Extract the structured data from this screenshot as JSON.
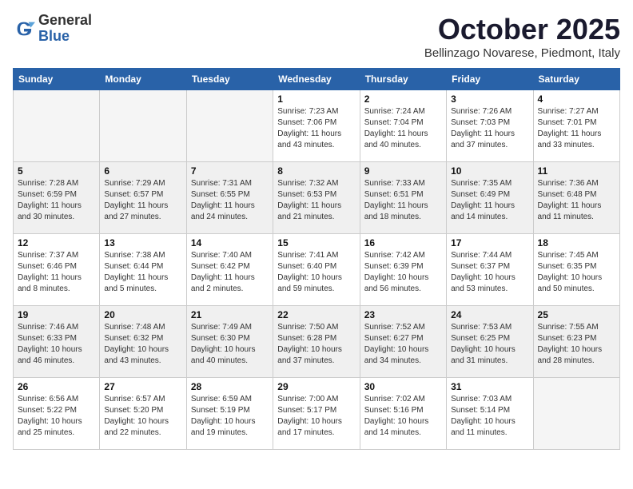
{
  "logo": {
    "general": "General",
    "blue": "Blue"
  },
  "title": "October 2025",
  "location": "Bellinzago Novarese, Piedmont, Italy",
  "weekdays": [
    "Sunday",
    "Monday",
    "Tuesday",
    "Wednesday",
    "Thursday",
    "Friday",
    "Saturday"
  ],
  "weeks": [
    [
      {
        "day": "",
        "info": ""
      },
      {
        "day": "",
        "info": ""
      },
      {
        "day": "",
        "info": ""
      },
      {
        "day": "1",
        "info": "Sunrise: 7:23 AM\nSunset: 7:06 PM\nDaylight: 11 hours\nand 43 minutes."
      },
      {
        "day": "2",
        "info": "Sunrise: 7:24 AM\nSunset: 7:04 PM\nDaylight: 11 hours\nand 40 minutes."
      },
      {
        "day": "3",
        "info": "Sunrise: 7:26 AM\nSunset: 7:03 PM\nDaylight: 11 hours\nand 37 minutes."
      },
      {
        "day": "4",
        "info": "Sunrise: 7:27 AM\nSunset: 7:01 PM\nDaylight: 11 hours\nand 33 minutes."
      }
    ],
    [
      {
        "day": "5",
        "info": "Sunrise: 7:28 AM\nSunset: 6:59 PM\nDaylight: 11 hours\nand 30 minutes."
      },
      {
        "day": "6",
        "info": "Sunrise: 7:29 AM\nSunset: 6:57 PM\nDaylight: 11 hours\nand 27 minutes."
      },
      {
        "day": "7",
        "info": "Sunrise: 7:31 AM\nSunset: 6:55 PM\nDaylight: 11 hours\nand 24 minutes."
      },
      {
        "day": "8",
        "info": "Sunrise: 7:32 AM\nSunset: 6:53 PM\nDaylight: 11 hours\nand 21 minutes."
      },
      {
        "day": "9",
        "info": "Sunrise: 7:33 AM\nSunset: 6:51 PM\nDaylight: 11 hours\nand 18 minutes."
      },
      {
        "day": "10",
        "info": "Sunrise: 7:35 AM\nSunset: 6:49 PM\nDaylight: 11 hours\nand 14 minutes."
      },
      {
        "day": "11",
        "info": "Sunrise: 7:36 AM\nSunset: 6:48 PM\nDaylight: 11 hours\nand 11 minutes."
      }
    ],
    [
      {
        "day": "12",
        "info": "Sunrise: 7:37 AM\nSunset: 6:46 PM\nDaylight: 11 hours\nand 8 minutes."
      },
      {
        "day": "13",
        "info": "Sunrise: 7:38 AM\nSunset: 6:44 PM\nDaylight: 11 hours\nand 5 minutes."
      },
      {
        "day": "14",
        "info": "Sunrise: 7:40 AM\nSunset: 6:42 PM\nDaylight: 11 hours\nand 2 minutes."
      },
      {
        "day": "15",
        "info": "Sunrise: 7:41 AM\nSunset: 6:40 PM\nDaylight: 10 hours\nand 59 minutes."
      },
      {
        "day": "16",
        "info": "Sunrise: 7:42 AM\nSunset: 6:39 PM\nDaylight: 10 hours\nand 56 minutes."
      },
      {
        "day": "17",
        "info": "Sunrise: 7:44 AM\nSunset: 6:37 PM\nDaylight: 10 hours\nand 53 minutes."
      },
      {
        "day": "18",
        "info": "Sunrise: 7:45 AM\nSunset: 6:35 PM\nDaylight: 10 hours\nand 50 minutes."
      }
    ],
    [
      {
        "day": "19",
        "info": "Sunrise: 7:46 AM\nSunset: 6:33 PM\nDaylight: 10 hours\nand 46 minutes."
      },
      {
        "day": "20",
        "info": "Sunrise: 7:48 AM\nSunset: 6:32 PM\nDaylight: 10 hours\nand 43 minutes."
      },
      {
        "day": "21",
        "info": "Sunrise: 7:49 AM\nSunset: 6:30 PM\nDaylight: 10 hours\nand 40 minutes."
      },
      {
        "day": "22",
        "info": "Sunrise: 7:50 AM\nSunset: 6:28 PM\nDaylight: 10 hours\nand 37 minutes."
      },
      {
        "day": "23",
        "info": "Sunrise: 7:52 AM\nSunset: 6:27 PM\nDaylight: 10 hours\nand 34 minutes."
      },
      {
        "day": "24",
        "info": "Sunrise: 7:53 AM\nSunset: 6:25 PM\nDaylight: 10 hours\nand 31 minutes."
      },
      {
        "day": "25",
        "info": "Sunrise: 7:55 AM\nSunset: 6:23 PM\nDaylight: 10 hours\nand 28 minutes."
      }
    ],
    [
      {
        "day": "26",
        "info": "Sunrise: 6:56 AM\nSunset: 5:22 PM\nDaylight: 10 hours\nand 25 minutes."
      },
      {
        "day": "27",
        "info": "Sunrise: 6:57 AM\nSunset: 5:20 PM\nDaylight: 10 hours\nand 22 minutes."
      },
      {
        "day": "28",
        "info": "Sunrise: 6:59 AM\nSunset: 5:19 PM\nDaylight: 10 hours\nand 19 minutes."
      },
      {
        "day": "29",
        "info": "Sunrise: 7:00 AM\nSunset: 5:17 PM\nDaylight: 10 hours\nand 17 minutes."
      },
      {
        "day": "30",
        "info": "Sunrise: 7:02 AM\nSunset: 5:16 PM\nDaylight: 10 hours\nand 14 minutes."
      },
      {
        "day": "31",
        "info": "Sunrise: 7:03 AM\nSunset: 5:14 PM\nDaylight: 10 hours\nand 11 minutes."
      },
      {
        "day": "",
        "info": ""
      }
    ]
  ]
}
